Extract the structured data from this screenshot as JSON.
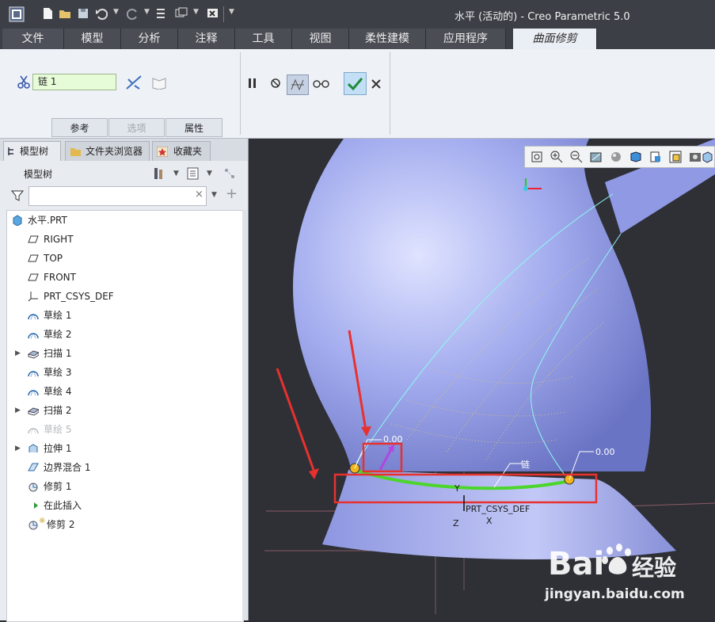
{
  "window": {
    "title": "水平 (活动的) - Creo Parametric 5.0"
  },
  "tabs": [
    {
      "label": "文件"
    },
    {
      "label": "模型"
    },
    {
      "label": "分析"
    },
    {
      "label": "注释"
    },
    {
      "label": "工具"
    },
    {
      "label": "视图"
    },
    {
      "label": "柔性建模"
    },
    {
      "label": "应用程序"
    },
    {
      "label": "曲面修剪",
      "active": true
    }
  ],
  "ribbon": {
    "chain_value": "链 1",
    "subtabs": [
      {
        "label": "参考"
      },
      {
        "label": "选项",
        "disabled": true
      },
      {
        "label": "属性"
      }
    ]
  },
  "panel": {
    "tabs": [
      {
        "label": "模型树"
      },
      {
        "label": "文件夹浏览器"
      },
      {
        "label": "收藏夹"
      }
    ],
    "header": "模型树",
    "filter_placeholder": ""
  },
  "tree": [
    {
      "label": "水平.PRT",
      "icon": "part-icon"
    },
    {
      "label": "RIGHT",
      "icon": "datum-plane-icon"
    },
    {
      "label": "TOP",
      "icon": "datum-plane-icon"
    },
    {
      "label": "FRONT",
      "icon": "datum-plane-icon"
    },
    {
      "label": "PRT_CSYS_DEF",
      "icon": "csys-icon"
    },
    {
      "label": "草绘 1",
      "icon": "sketch-icon"
    },
    {
      "label": "草绘 2",
      "icon": "sketch-icon"
    },
    {
      "label": "扫描 1",
      "icon": "sweep-icon",
      "expandable": true
    },
    {
      "label": "草绘 3",
      "icon": "sketch-icon"
    },
    {
      "label": "草绘 4",
      "icon": "sketch-icon"
    },
    {
      "label": "扫描 2",
      "icon": "sweep-icon",
      "expandable": true
    },
    {
      "label": "草绘 5",
      "icon": "sketch-icon",
      "disabled": true
    },
    {
      "label": "拉伸 1",
      "icon": "extrude-icon",
      "expandable": true
    },
    {
      "label": "边界混合 1",
      "icon": "boundary-blend-icon"
    },
    {
      "label": "修剪 1",
      "icon": "trim-icon"
    },
    {
      "label": "在此插入",
      "icon": "insert-here-icon"
    },
    {
      "label": "修剪 2",
      "icon": "trim-icon",
      "prefix": "※"
    }
  ],
  "viewport": {
    "dim_left": "0.00",
    "dim_right": "0.00",
    "chain_label": "链",
    "csys_label": "PRT_CSYS_DEF",
    "axis_y": "Y",
    "axis_z": "Z",
    "axis_x": "X"
  },
  "watermark": {
    "brand": "Bai",
    "brand2": "经验",
    "url": "jingyan.baidu.com"
  },
  "colors": {
    "surface": "#a9b1f0",
    "chain": "#4cd62b",
    "highlight_box": "#e8312f",
    "accent_tab": "#eaeef5"
  }
}
